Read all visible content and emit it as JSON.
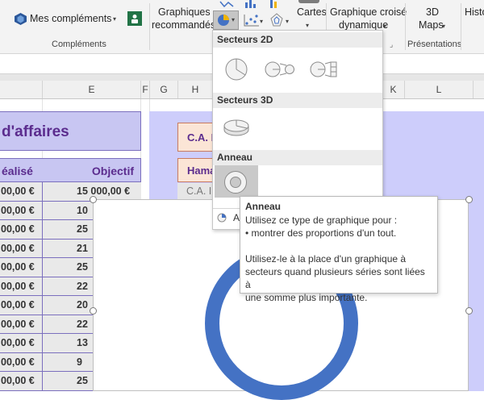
{
  "ribbon": {
    "addins_button": "Mes compléments",
    "addins_group": "Compléments",
    "recommended_line1": "Graphiques",
    "recommended_line2": "recommandés",
    "maps_label": "Cartes",
    "pivotchart_line1": "Graphique croisé",
    "pivotchart_line2": "dynamique",
    "maps3d_line1": "3D",
    "maps3d_line2": "Maps",
    "tours_group": "Présentations",
    "history_label": "Histo"
  },
  "columns": {
    "e": "E",
    "f": "F",
    "g": "G",
    "h": "H",
    "k": "K",
    "l": "L"
  },
  "sheet": {
    "title_fragment": "d'affaires",
    "header_realise": "éalisé",
    "header_objectif": "Objectif",
    "rows": [
      {
        "a": "00,00 €",
        "b": "15 000,00 €"
      },
      {
        "a": "00,00 €",
        "b": "10"
      },
      {
        "a": "00,00 €",
        "b": "25"
      },
      {
        "a": "00,00 €",
        "b": "21"
      },
      {
        "a": "00,00 €",
        "b": "25"
      },
      {
        "a": "00,00 €",
        "b": "22"
      },
      {
        "a": "00,00 €",
        "b": "20"
      },
      {
        "a": "00,00 €",
        "b": "22"
      },
      {
        "a": "00,00 €",
        "b": "13"
      },
      {
        "a": "00,00 €",
        "b": "9"
      },
      {
        "a": "00,00 €",
        "b": "25"
      }
    ],
    "right_label1": "C.A. F",
    "right_label2": "Hama",
    "right_label3": "C.A. In"
  },
  "dropdown": {
    "section_2d": "Secteurs 2D",
    "section_3d": "Secteurs 3D",
    "section_donut": "Anneau",
    "more_fragment": "A"
  },
  "tooltip": {
    "title": "Anneau",
    "line1": "Utilisez ce type de graphique pour :",
    "line2": "• montrer des proportions d'un tout.",
    "line3": "Utilisez-le à la place d'un graphique à",
    "line4": "secteurs quand plusieurs séries sont liées à",
    "line5": "une somme plus importante."
  },
  "colors": {
    "donut": "#4472c4",
    "lavender": "#cdcdfb",
    "table_header": "#c8c6f2",
    "title_text": "#5b2c8e",
    "salmon": "#fbe5d6"
  }
}
